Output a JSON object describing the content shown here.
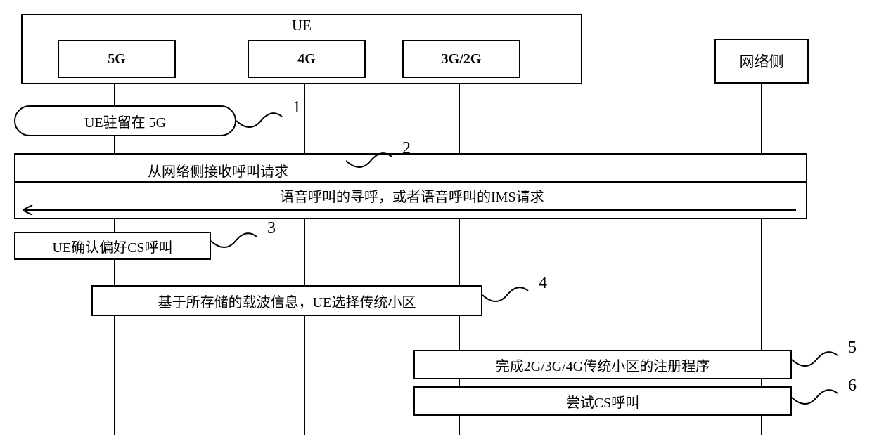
{
  "header": {
    "ue_label": "UE",
    "tech_5g": "5G",
    "tech_4g": "4G",
    "tech_3g2g": "3G/2G",
    "network_side": "网络侧"
  },
  "steps": {
    "s1": {
      "num": "1",
      "text": "UE驻留在 5G"
    },
    "s2": {
      "num": "2",
      "header": "从网络侧接收呼叫请求",
      "desc": "语音呼叫的寻呼，或者语音呼叫的IMS请求"
    },
    "s3": {
      "num": "3",
      "text": "UE确认偏好CS呼叫"
    },
    "s4": {
      "num": "4",
      "text": "基于所存储的载波信息，UE选择传统小区"
    },
    "s5": {
      "num": "5",
      "text": "完成2G/3G/4G传统小区的注册程序"
    },
    "s6": {
      "num": "6",
      "text": "尝试CS呼叫"
    }
  }
}
